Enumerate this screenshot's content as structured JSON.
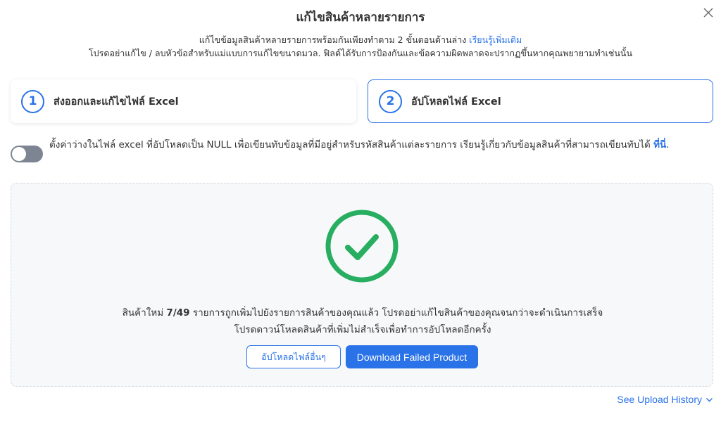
{
  "modal": {
    "title": "แก้ไขสินค้าหลายรายการ",
    "subtitle_text": "แก้ไขข้อมูลสินค้าหลายรายการพร้อมกันเพียงทำตาม 2 ขั้นตอนด้านล่าง",
    "subtitle_link": "เรียนรู้เพิ่มเติม",
    "warning": "โปรดอย่าแก้ไข / ลบหัวข้อสำหรับแม่แบบการแก้ไขขนาดมวล. ฟิลด์ได้รับการป้องกันและข้อความผิดพลาดจะปรากฏขึ้นหากคุณพยายามทำเช่นนั้น",
    "close_icon": "close-icon"
  },
  "steps": [
    {
      "number": "1",
      "label": "ส่งออกและแก้ไขไฟล์ Excel"
    },
    {
      "number": "2",
      "label": "อัปโหลดไฟล์ Excel"
    }
  ],
  "toggle": {
    "state": "off",
    "text": "ตั้งค่าว่างในไฟล์ excel ที่อัปโหลดเป็น NULL เพื่อเขียนทับข้อมูลที่มีอยู่สำหรับรหัสสินค้าแต่ละรายการ เรียนรู้เกี่ยวกับข้อมูลสินค้าที่สามารถเขียนทับได้",
    "link": "ที่นี่",
    "suffix": "."
  },
  "result": {
    "icon": "check-circle-icon",
    "msg_prefix": "สินค้าใหม่",
    "count": "7/49",
    "msg_suffix": "รายการถูกเพิ่มไปยังรายการสินค้าของคุณแล้ว โปรดอย่าแก้ไขสินค้าของคุณจนกว่าจะดำเนินการเสร็จ",
    "msg_line2": "โปรดดาวน์โหลดสินค้าที่เพิ่มไม่สำเร็จเพื่อทำการอัปโหลดอีกครั้ง",
    "btn_upload_other": "อัปโหลดไฟล์อื่นๆ",
    "btn_download_failed": "Download Failed Product"
  },
  "footer": {
    "history_link": "See Upload History"
  },
  "colors": {
    "accent": "#2a72e8",
    "success": "#27ae60",
    "toggle_off": "#7d8592"
  }
}
